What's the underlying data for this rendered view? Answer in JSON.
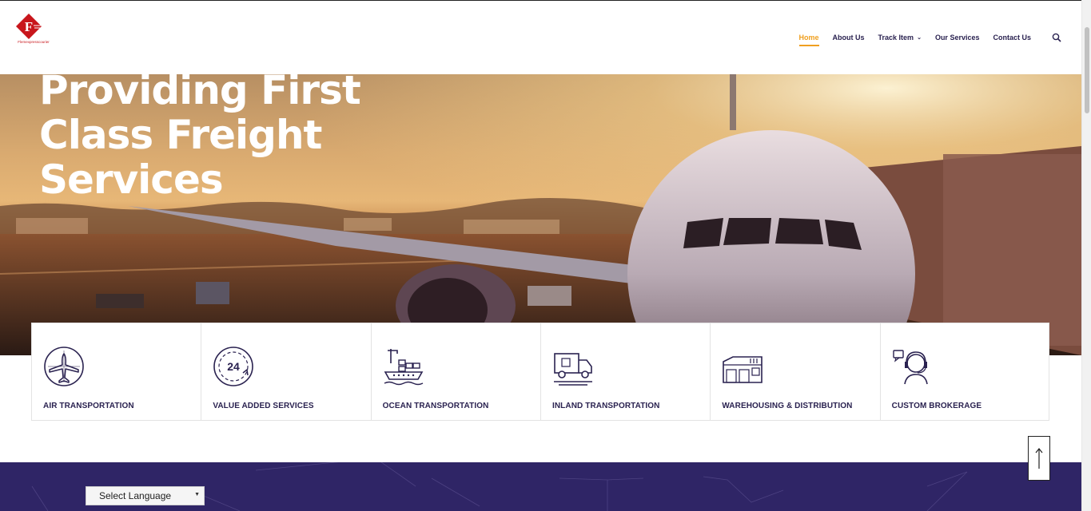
{
  "nav": {
    "items": [
      {
        "label": "Home",
        "active": true
      },
      {
        "label": "About Us"
      },
      {
        "label": "Track Item",
        "has_dropdown": true
      },
      {
        "label": "Our Services"
      },
      {
        "label": "Contact Us"
      }
    ],
    "active_color": "#f0a020",
    "text_color": "#2a2250"
  },
  "logo": {
    "letter": "F",
    "caption": "Flemexpresscourier",
    "color": "#c8161c"
  },
  "hero": {
    "title_lines": [
      "Providing First",
      "Class Freight",
      "Services"
    ]
  },
  "services": [
    {
      "label": "AIR TRANSPORTATION",
      "icon": "airplane-globe-icon"
    },
    {
      "label": "VALUE ADDED SERVICES",
      "icon": "24-hour-icon"
    },
    {
      "label": "OCEAN TRANSPORTATION",
      "icon": "cargo-ship-icon"
    },
    {
      "label": "INLAND TRANSPORTATION",
      "icon": "delivery-truck-icon"
    },
    {
      "label": "WAREHOUSING & DISTRIBUTION",
      "icon": "warehouse-icon"
    },
    {
      "label": "CUSTOM BROKERAGE",
      "icon": "support-agent-icon"
    }
  ],
  "footer": {
    "language_select": "Select Language",
    "background": "#2f2566"
  },
  "back_to_top_icon": "arrow-up-icon"
}
